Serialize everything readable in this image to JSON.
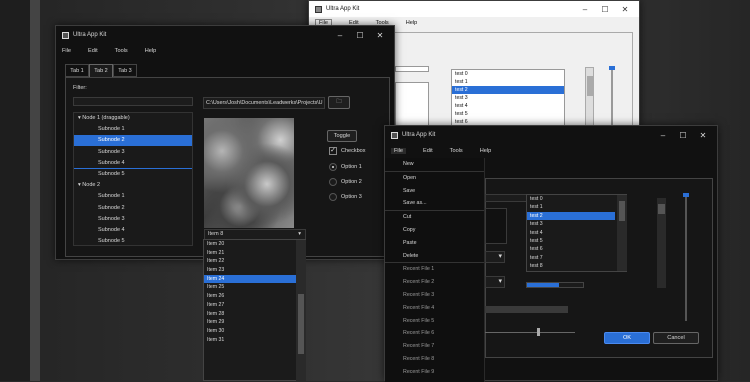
{
  "light_window": {
    "title": "Ultra App Kit",
    "menu": [
      "File",
      "Edit",
      "Tools",
      "Help"
    ],
    "list": [
      "test 0",
      "test 1",
      "test 2",
      "test 3",
      "test 4",
      "test 5",
      "test 6"
    ],
    "selected": 2
  },
  "win_a": {
    "title": "Ultra App Kit",
    "menu": [
      "File",
      "Edit",
      "Tools",
      "Help"
    ],
    "tabs": [
      "Tab 1",
      "Tab 2",
      "Tab 3"
    ],
    "filter_label": "Filter:",
    "path": "C:\\Users\\Josh\\Documents\\Leadwerks\\Projects\\U",
    "tree": [
      "Node 1 (draggable)",
      "Subnode 1",
      "Subnode 2",
      "Subnode 3",
      "Subnode 4",
      "Subnode 5",
      "Node 2",
      "Subnode 1",
      "Subnode 2",
      "Subnode 3",
      "Subnode 4",
      "Subnode 5"
    ],
    "toggle": "Toggle",
    "checkbox": "Checkbox",
    "options": [
      "Option 1",
      "Option 2",
      "Option 3"
    ],
    "combo_value": "Item 8",
    "dropdown": [
      "Item 20",
      "Item 21",
      "Item 22",
      "Item 23",
      "Item 24",
      "Item 25",
      "Item 26",
      "Item 27",
      "Item 28",
      "Item 29",
      "Item 30",
      "Item 31"
    ]
  },
  "win_b": {
    "title": "Ultra App Kit",
    "menu": [
      "File",
      "Edit",
      "Tools",
      "Help"
    ],
    "file_menu": [
      "New",
      "Open",
      "Save",
      "Save as...",
      "Cut",
      "Copy",
      "Paste",
      "Delete",
      "Recent File 1",
      "Recent File 2",
      "Recent File 3",
      "Recent File 4",
      "Recent File 5",
      "Recent File 6",
      "Recent File 7",
      "Recent File 8",
      "Recent File 9"
    ],
    "list": [
      "test 0",
      "test 1",
      "test 2",
      "test 3",
      "test 4",
      "test 5",
      "test 6",
      "test 7",
      "test 8"
    ],
    "ok": "OK",
    "cancel": "Cancel"
  },
  "colors": {
    "accent": "#2a6fd6",
    "bg_dark": "#111111"
  }
}
